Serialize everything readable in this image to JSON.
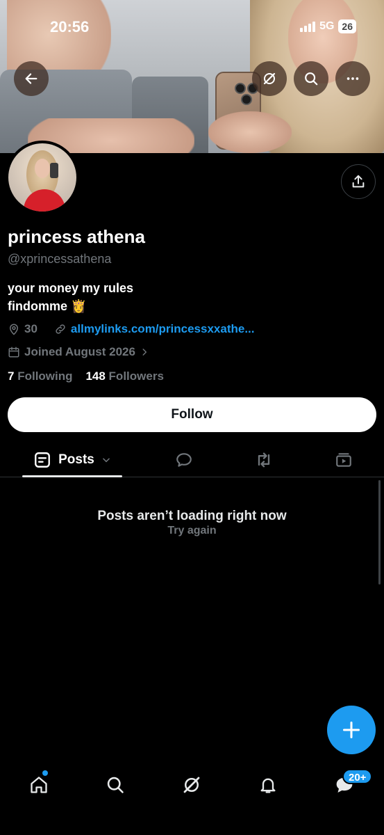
{
  "status_bar": {
    "time": "20:56",
    "network": "5G",
    "battery": "26"
  },
  "profile": {
    "name": "princess athena",
    "handle": "@xprincessathena",
    "bio_line1": "your money my rules",
    "bio_line2": "findomme 👸",
    "location": "30",
    "link": "allmylinks.com/princessxxathe...",
    "joined": "Joined August 2026",
    "following_count": "7",
    "following_label": "Following",
    "followers_count": "148",
    "followers_label": "Followers"
  },
  "actions": {
    "follow_label": "Follow"
  },
  "tabs": [
    {
      "label": "Posts",
      "icon": "posts-icon",
      "active": true
    },
    {
      "label": "",
      "icon": "replies-icon"
    },
    {
      "label": "",
      "icon": "reposts-icon"
    },
    {
      "label": "",
      "icon": "media-icon"
    }
  ],
  "feed": {
    "empty_title": "Posts aren’t loading right now",
    "retry_label": "Try again"
  },
  "bottom_nav": {
    "messages_badge": "20+"
  },
  "colors": {
    "accent": "#1d9bf0",
    "background": "#000000",
    "muted": "#71767b"
  }
}
